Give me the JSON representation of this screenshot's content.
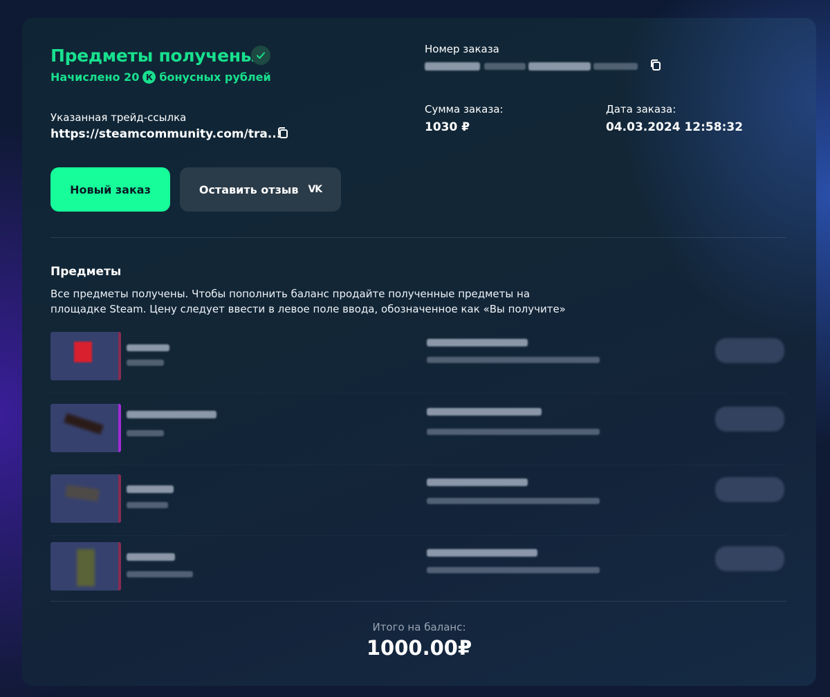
{
  "status": {
    "title": "Предметы получены",
    "bonus_prefix": "Начислено 20",
    "bonus_coin": "К",
    "bonus_suffix": "бонусных рублей"
  },
  "trade_link": {
    "label": "Указанная трейд-ссылка",
    "value": "https://steamcommunity.com/tra..."
  },
  "order": {
    "number_label": "Номер заказа",
    "sum_label": "Сумма заказа:",
    "sum_value": "1030 ₽",
    "date_label": "Дата заказа:",
    "date_value": "04.03.2024 12:58:32"
  },
  "buttons": {
    "new_order": "Новый заказ",
    "leave_review": "Оставить отзыв",
    "vk_glyph": "VK"
  },
  "items_section": {
    "title": "Предметы",
    "description": "Все предметы получены. Чтобы пополнить баланс продайте полученные предметы на площадке Steam. Цену следует ввести в левое поле ввода, обозначенное как «Вы получите»"
  },
  "items": [
    {
      "rarity_color": "#8a2b52",
      "icon": "sticker-icon"
    },
    {
      "rarity_color": "#a22ad6",
      "icon": "knife-icon"
    },
    {
      "rarity_color": "#8a2b52",
      "icon": "pistol-icon"
    },
    {
      "rarity_color": "#8a2b52",
      "icon": "agent-icon"
    }
  ],
  "total": {
    "label": "Итого на баланс:",
    "value": "1000.00₽"
  },
  "colors": {
    "accent": "#16fd9a",
    "status_green": "#18e08e"
  }
}
